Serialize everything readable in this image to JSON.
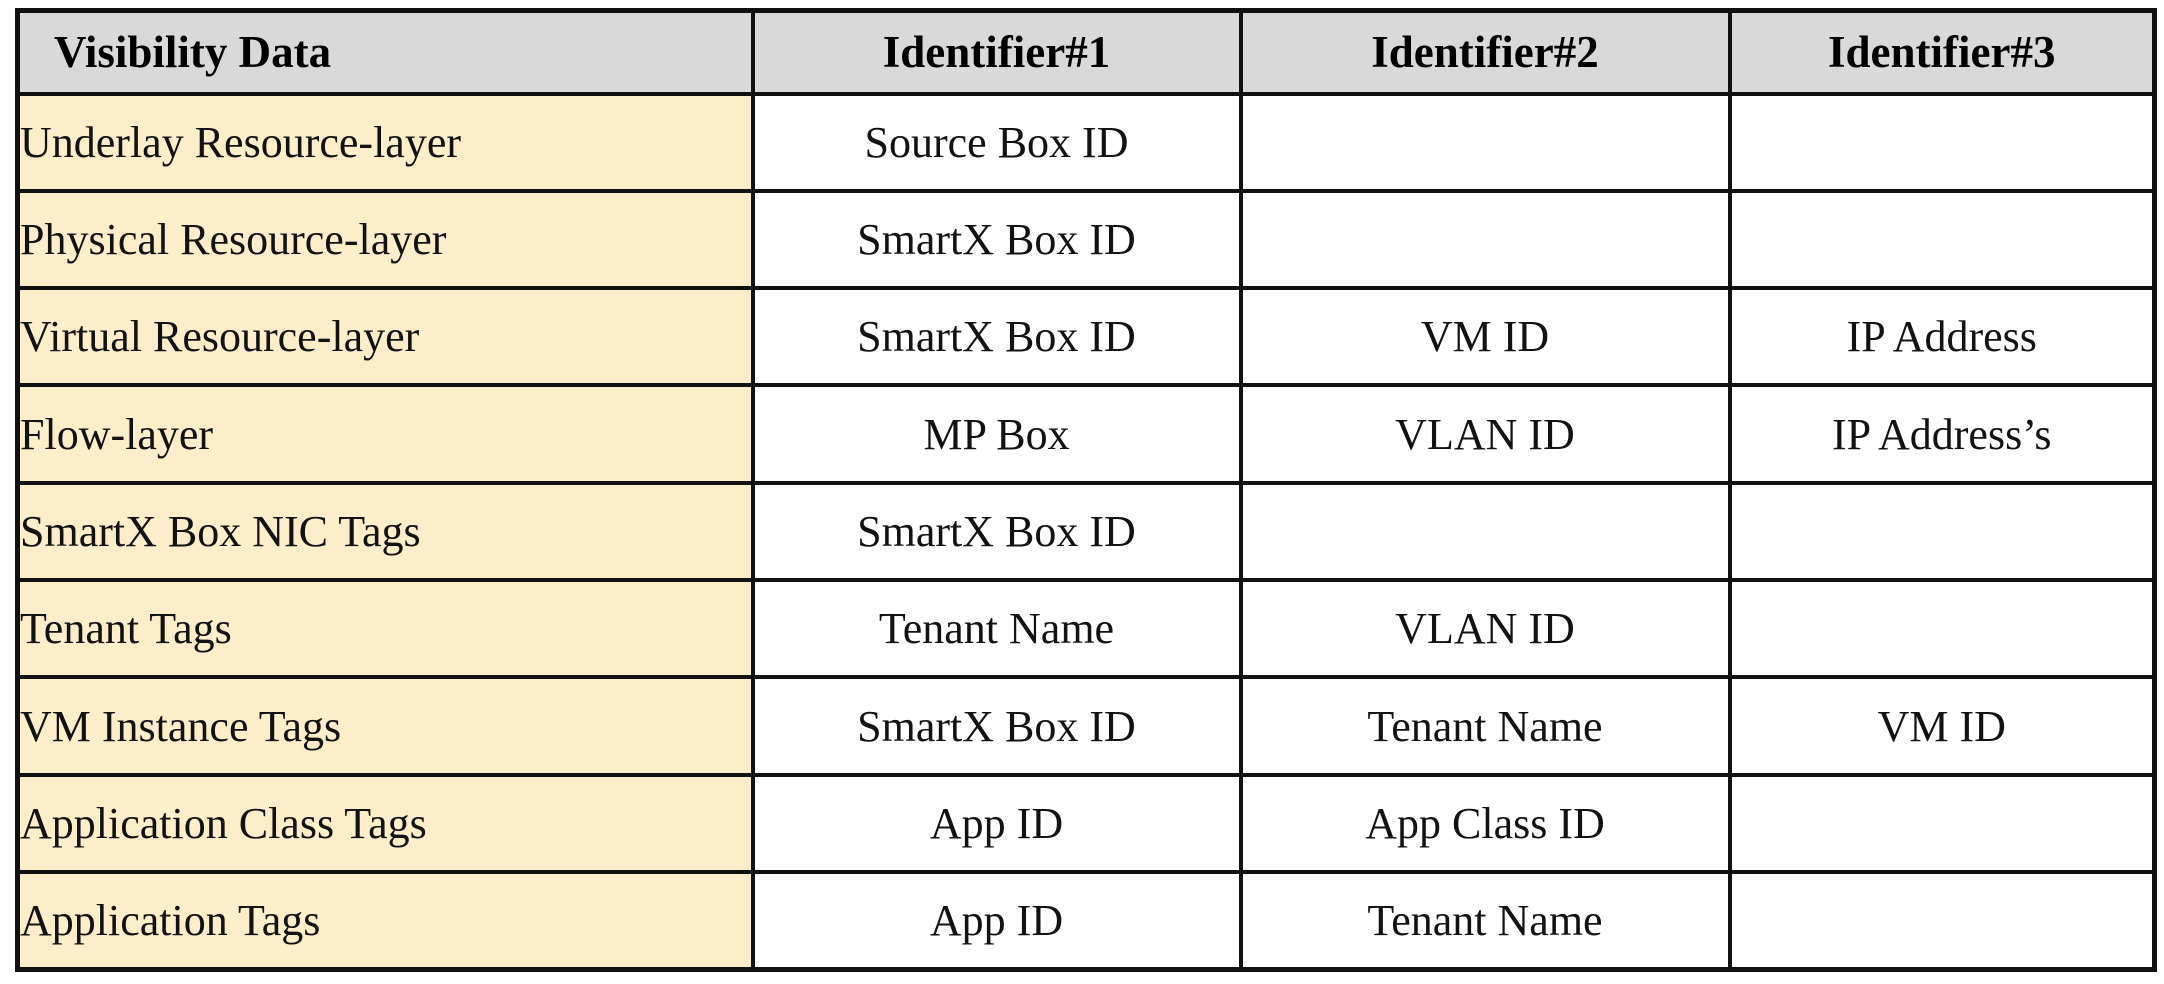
{
  "table": {
    "columns": [
      {
        "key": "visibility_data",
        "label": "Visibility Data",
        "align": "left"
      },
      {
        "key": "identifier_1",
        "label": "Identifier#1",
        "align": "center"
      },
      {
        "key": "identifier_2",
        "label": "Identifier#2",
        "align": "center"
      },
      {
        "key": "identifier_3",
        "label": "Identifier#3",
        "align": "center"
      }
    ],
    "colors": {
      "header_background": "#d9d9d9",
      "label_background": "#fceecb",
      "cell_background": "#ffffff",
      "border": "#111111",
      "text": "#121212"
    },
    "rows": [
      {
        "visibility_data": "Underlay Resource-layer",
        "identifier_1": "Source Box ID",
        "identifier_2": "",
        "identifier_3": ""
      },
      {
        "visibility_data": "Physical Resource-layer",
        "identifier_1": "SmartX Box ID",
        "identifier_2": "",
        "identifier_3": ""
      },
      {
        "visibility_data": "Virtual Resource-layer",
        "identifier_1": "SmartX Box ID",
        "identifier_2": "VM ID",
        "identifier_3": "IP Address"
      },
      {
        "visibility_data": "Flow-layer",
        "identifier_1": "MP Box",
        "identifier_2": "VLAN ID",
        "identifier_3": "IP Address’s"
      },
      {
        "visibility_data": "SmartX Box NIC Tags",
        "identifier_1": "SmartX Box ID",
        "identifier_2": "",
        "identifier_3": ""
      },
      {
        "visibility_data": "Tenant Tags",
        "identifier_1": "Tenant Name",
        "identifier_2": "VLAN ID",
        "identifier_3": ""
      },
      {
        "visibility_data": "VM Instance Tags",
        "identifier_1": "SmartX Box ID",
        "identifier_2": "Tenant Name",
        "identifier_3": "VM ID"
      },
      {
        "visibility_data": "Application Class Tags",
        "identifier_1": "App ID",
        "identifier_2": "App Class ID",
        "identifier_3": ""
      },
      {
        "visibility_data": "Application Tags",
        "identifier_1": "App ID",
        "identifier_2": "Tenant Name",
        "identifier_3": ""
      }
    ]
  }
}
